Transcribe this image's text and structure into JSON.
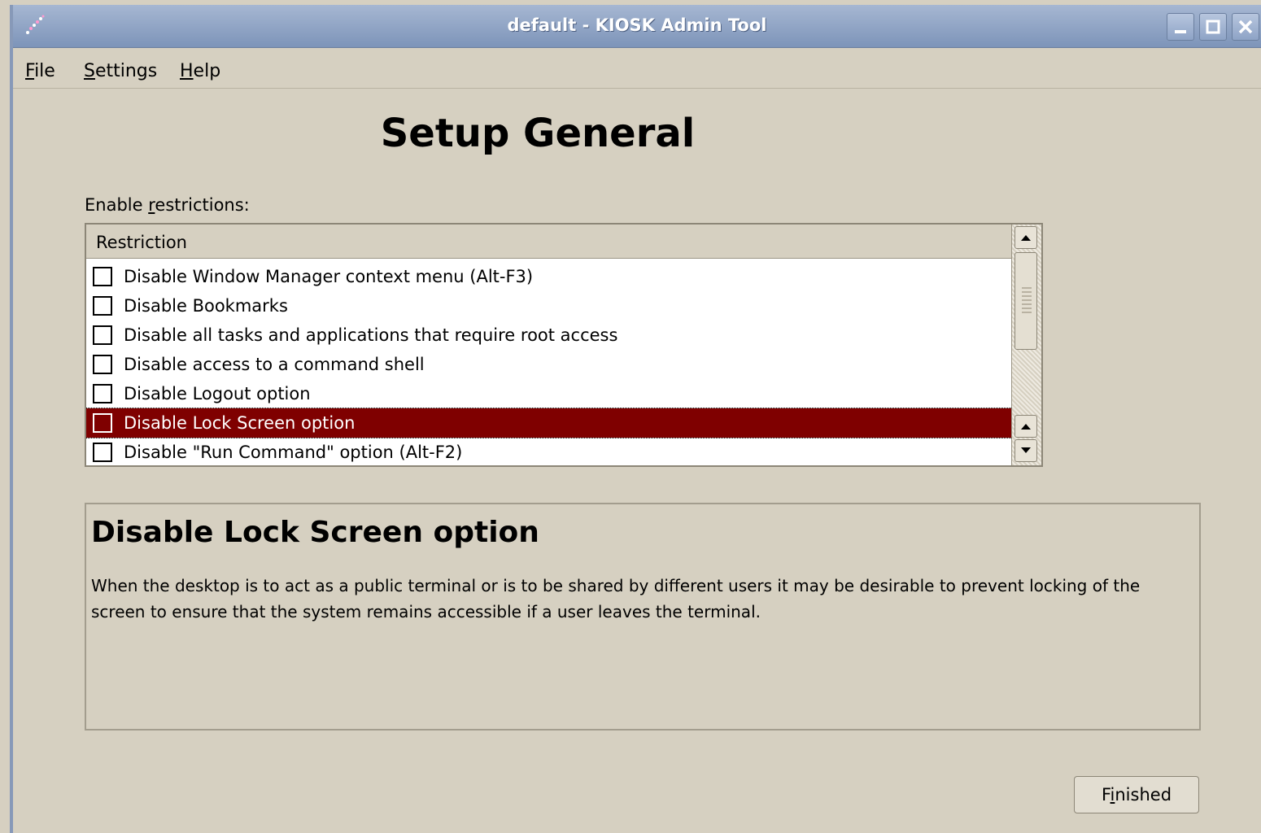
{
  "window": {
    "title": "default - KIOSK Admin Tool",
    "icon": "kiosk-app-icon"
  },
  "menu": [
    {
      "mnemonic": "F",
      "rest": "ile"
    },
    {
      "mnemonic": "S",
      "rest": "ettings"
    },
    {
      "mnemonic": "H",
      "rest": "elp"
    }
  ],
  "page": {
    "heading": "Setup General",
    "restrictions_label_pre": "Enable ",
    "restrictions_label_mnemonic": "r",
    "restrictions_label_post": "estrictions:"
  },
  "list": {
    "column_header": "Restriction",
    "rows": [
      {
        "label": "Disable Window Manager context menu (Alt-F3)",
        "checked": false
      },
      {
        "label": "Disable Bookmarks",
        "checked": false
      },
      {
        "label": "Disable all tasks and applications that require root access",
        "checked": false
      },
      {
        "label": "Disable access to a command shell",
        "checked": false
      },
      {
        "label": "Disable Logout option",
        "checked": false
      },
      {
        "label": "Disable Lock Screen option",
        "checked": false,
        "selected": true
      },
      {
        "label": "Disable \"Run Command\" option (Alt-F2)",
        "checked": false
      }
    ]
  },
  "description": {
    "title": "Disable Lock Screen option",
    "text": "When the desktop is to act as a public terminal or is to be shared by different users it may be desirable to prevent locking of the screen to ensure that the system remains accessible if a user leaves the terminal."
  },
  "buttons": {
    "finished_pre": "F",
    "finished_mnemonic": "i",
    "finished_post": "nished"
  },
  "colors": {
    "selection": "#7f0000",
    "background": "#d6d0c1",
    "titlebar": "#8ea3c6"
  }
}
